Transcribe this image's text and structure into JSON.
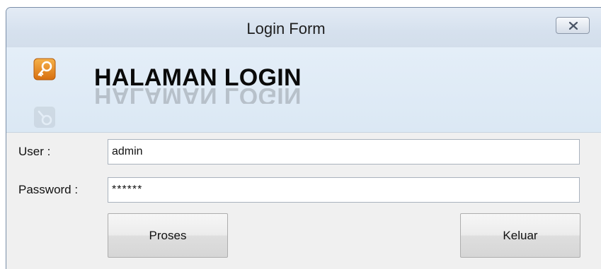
{
  "window": {
    "title": "Login Form",
    "close_icon": "close-x-icon"
  },
  "banner": {
    "icon": "key-icon",
    "icon_color": "#e8891c",
    "heading": "HALAMAN LOGIN"
  },
  "form": {
    "user_label": "User :",
    "user_value": "admin",
    "password_label": "Password :",
    "password_value": "******"
  },
  "buttons": {
    "submit_label": "Proses",
    "exit_label": "Keluar"
  }
}
